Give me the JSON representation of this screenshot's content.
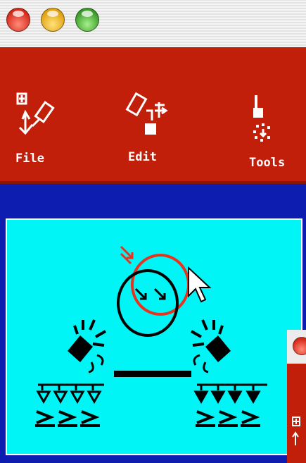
{
  "window": {
    "traffic_lights": [
      "close",
      "minimize",
      "zoom"
    ]
  },
  "toolbar": {
    "background": "#c11f0a",
    "items": [
      {
        "label": "File",
        "icon": "file-icon"
      },
      {
        "label": "Edit",
        "icon": "edit-icon"
      },
      {
        "label": "Tools",
        "icon": "tools-icon"
      }
    ]
  },
  "canvas": {
    "background": "#00f6f6",
    "frame_color": "#0c1db0",
    "highlight_color": "#e8321e"
  }
}
